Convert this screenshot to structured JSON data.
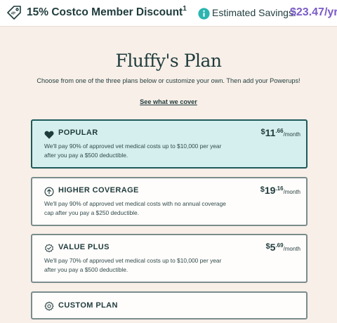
{
  "top_bar": {
    "discount_label": "15% Costco Member Discount",
    "discount_footnote": "1",
    "savings_label": "Estimated Savings:",
    "savings_value": "$23.47/yr.",
    "accent_color": "#7b5cc7",
    "info_icon_color": "#2bb5b0"
  },
  "header": {
    "title": "Fluffy's Plan",
    "subtitle": "Choose from one of the three plans below or customize your own. Then add your Powerups!",
    "cover_link": "See what we cover"
  },
  "plans": [
    {
      "name": "POPULAR",
      "icon": "heart-icon",
      "selected": true,
      "description": "We'll pay 90% of approved vet medical costs up to $10,000 per year after you pay a $500 deductible.",
      "price_dollar": "$",
      "price_whole": "11",
      "price_cents": ".66",
      "price_period": "/month"
    },
    {
      "name": "HIGHER COVERAGE",
      "icon": "arrow-up-circle-icon",
      "selected": false,
      "description": "We'll pay 90% of approved vet medical costs with no annual coverage cap after you pay a $250 deductible.",
      "price_dollar": "$",
      "price_whole": "19",
      "price_cents": ".16",
      "price_period": "/month"
    },
    {
      "name": "VALUE PLUS",
      "icon": "check-badge-icon",
      "selected": false,
      "description": "We'll pay 70% of approved vet medical costs up to $10,000 per year after you pay a $500 deductible.",
      "price_dollar": "$",
      "price_whole": "5",
      "price_cents": ".69",
      "price_period": "/month"
    },
    {
      "name": "CUSTOM PLAN",
      "icon": "gear-icon",
      "selected": false
    }
  ]
}
